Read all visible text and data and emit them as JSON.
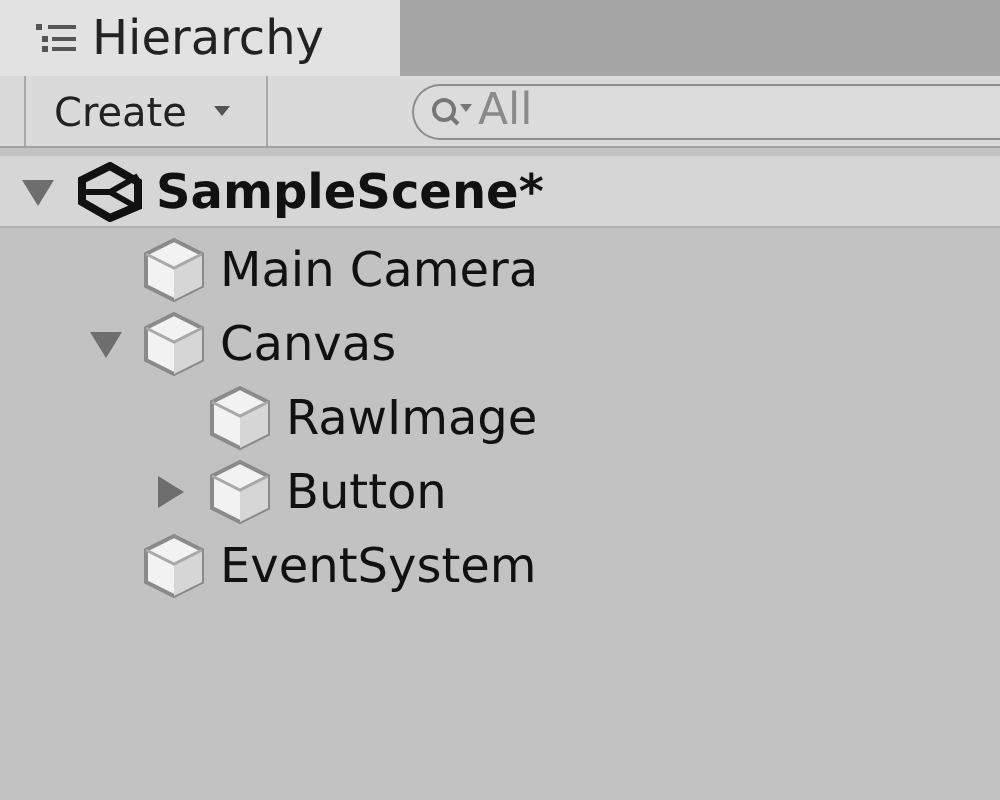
{
  "tab": {
    "label": "Hierarchy",
    "selected": true
  },
  "toolbar": {
    "create_button": "Create",
    "search": {
      "placeholder": "All"
    }
  },
  "scene": {
    "name": "SampleScene*",
    "expanded": true,
    "children": [
      {
        "name": "Main Camera",
        "kind": "leaf"
      },
      {
        "name": "Canvas",
        "kind": "group",
        "expanded": true,
        "children": [
          {
            "name": "RawImage",
            "kind": "leaf"
          },
          {
            "name": "Button",
            "kind": "group",
            "expanded": false
          }
        ]
      },
      {
        "name": "EventSystem",
        "kind": "leaf"
      }
    ]
  }
}
